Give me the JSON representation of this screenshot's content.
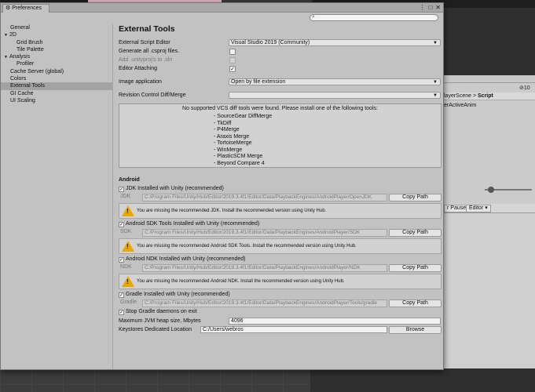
{
  "window": {
    "tab_title": "Preferences",
    "tab_icon": "gear-icon",
    "controls": [
      "⋮",
      "□",
      "✕"
    ]
  },
  "search": {
    "placeholder": ""
  },
  "sidebar": {
    "items": [
      {
        "label": "General",
        "level": 0,
        "selected": false
      },
      {
        "label": "2D",
        "level": 0,
        "fold": "▼"
      },
      {
        "label": "Grid Brush",
        "level": 1
      },
      {
        "label": "Tile Palette",
        "level": 1
      },
      {
        "label": "Analysis",
        "level": 0,
        "fold": "▼"
      },
      {
        "label": "Profiler",
        "level": 1
      },
      {
        "label": "Cache Server (global)",
        "level": 0
      },
      {
        "label": "Colors",
        "level": 0
      },
      {
        "label": "External Tools",
        "level": 0,
        "selected": true
      },
      {
        "label": "GI Cache",
        "level": 0
      },
      {
        "label": "UI Scaling",
        "level": 0
      }
    ]
  },
  "main": {
    "title": "External Tools",
    "script_editor_label": "External Script Editor",
    "script_editor_value": "Visual Studio 2019 (Community)",
    "generate_csproj_label": "Generate all .csproj files.",
    "add_unityproj_label": "Add .unityproj's to .sln",
    "editor_attaching_label": "Editor Attaching",
    "image_app_label": "Image application",
    "image_app_value": "Open by file extension",
    "vcs_label": "Revision Control Diff/Merge",
    "vcs_value": "",
    "vcs_message": "No supported VCS diff tools were found. Please install one of the following tools:",
    "vcs_tools": [
      "- SourceGear DiffMerge",
      "- TkDiff",
      "- P4Merge",
      "- Araxis Merge",
      "- TortoiseMerge",
      "- WinMerge",
      "- PlasticSCM Merge",
      "- Beyond Compare 4"
    ],
    "android_heading": "Android",
    "jdk": {
      "check_label": "JDK Installed with Unity (recommended)",
      "tag": "JDK",
      "path": "C:/Program Files/Unity/Hub/Editor/2019.3.4f1/Editor/Data/PlaybackEngines/AndroidPlayer/OpenJDK",
      "button": "Copy Path",
      "warning": "You are missing the recommended JDK. Install the recommended version using Unity Hub."
    },
    "sdk": {
      "check_label": "Android SDK Tools Installed with Unity (recommended)",
      "tag": "SDK",
      "path": "C:/Program Files/Unity/Hub/Editor/2019.3.4f1/Editor/Data/PlaybackEngines/AndroidPlayer/SDK",
      "button": "Copy Path",
      "warning": "You are missing the recommended Android SDK Tools. Install the recommended version using Unity Hub."
    },
    "ndk": {
      "check_label": "Android NDK Installed with Unity (recommended)",
      "tag": "NDK",
      "path": "C:/Program Files/Unity/Hub/Editor/2019.3.4f1/Editor/Data/PlaybackEngines/AndroidPlayer/NDK",
      "button": "Copy Path",
      "warning": "You are missing the recommended Android NDK. Install the recommended version using Unity Hub."
    },
    "gradle": {
      "check_label": "Gradle Installed with Unity (recommended)",
      "tag": "Gradle",
      "path": "C:/Program Files/Unity/Hub/Editor/2019.3.4f1/Editor/Data/PlaybackEngines/AndroidPlayer/Tools/gradle",
      "button": "Copy Path"
    },
    "stop_gradle_label": "Stop Gradle daemons on exit",
    "jvm_heap_label": "Maximum JVM heap size, Mbytes",
    "jvm_heap_value": "4096",
    "keystores_label": "Keystores Dedicated Location",
    "keystores_value": "C:/Users/webros",
    "browse_button": "Browse"
  },
  "background": {
    "inspector_tabs": "layerScene",
    "inspector_script": "Script",
    "inspector_text": "erActiveAnim",
    "inspector_count": "10",
    "pause_label": "r Pause",
    "editor_label": "Editor"
  }
}
